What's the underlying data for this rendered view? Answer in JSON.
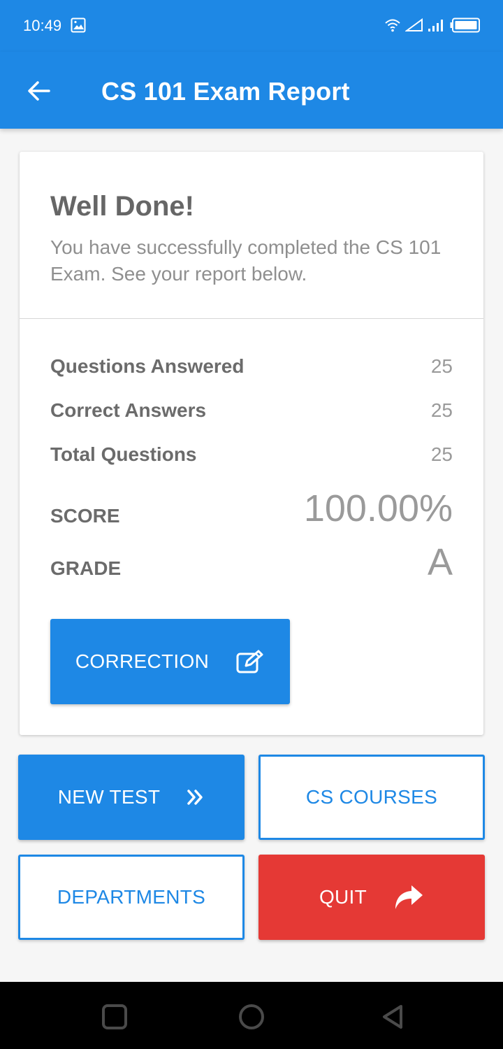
{
  "status_bar": {
    "time": "10:49",
    "icons": [
      "gallery-icon",
      "wifi-icon",
      "signal-outline-icon",
      "signal-bars-icon",
      "battery-icon"
    ]
  },
  "app_bar": {
    "title": "CS 101 Exam Report",
    "back_icon": "arrow-left-icon"
  },
  "summary": {
    "heading": "Well Done!",
    "message": "You have successfully completed the CS 101 Exam. See your report below."
  },
  "results": [
    {
      "label": "Questions Answered",
      "value": "25"
    },
    {
      "label": "Correct Answers",
      "value": "25"
    },
    {
      "label": "Total Questions",
      "value": "25"
    }
  ],
  "score": {
    "label": "SCORE",
    "value": "100.00%"
  },
  "grade": {
    "label": "GRADE",
    "value": "A"
  },
  "buttons": {
    "correction": {
      "label": "CORRECTION",
      "icon": "edit-icon"
    },
    "new_test": {
      "label": "NEW TEST",
      "icon": "double-chevron-right-icon"
    },
    "cs_courses": {
      "label": "CS COURSES"
    },
    "departments": {
      "label": "DEPARTMENTS"
    },
    "quit": {
      "label": "QUIT",
      "icon": "share-arrow-icon"
    }
  },
  "colors": {
    "primary": "#1e88e5",
    "danger": "#e53935",
    "background": "#f6f6f6"
  },
  "nav_bar": {
    "icons": [
      "recents-square-icon",
      "home-circle-icon",
      "back-triangle-icon"
    ]
  }
}
